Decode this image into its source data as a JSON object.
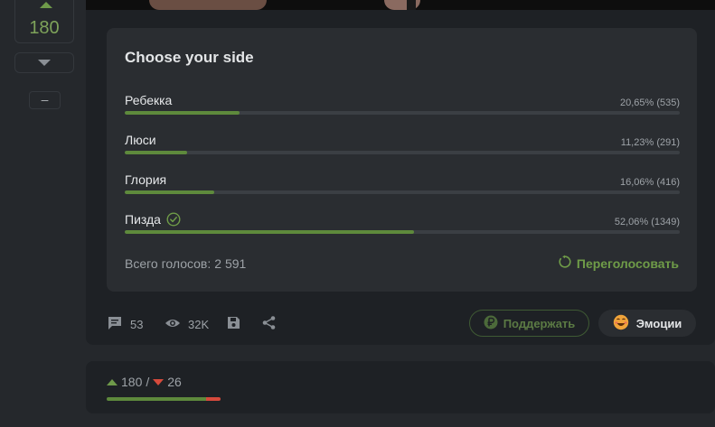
{
  "rating": {
    "score": "180",
    "collapse_label": "–",
    "up": "180",
    "separator": "/",
    "down": "26",
    "up_fraction": 0.8738
  },
  "poll": {
    "title": "Choose your side",
    "options": [
      {
        "label": "Ребекка",
        "stat": "20,65% (535)",
        "percent": 20.65,
        "selected": false
      },
      {
        "label": "Люси",
        "stat": "11,23% (291)",
        "percent": 11.23,
        "selected": false
      },
      {
        "label": "Глория",
        "stat": "16,06% (416)",
        "percent": 16.06,
        "selected": false
      },
      {
        "label": "Пизда",
        "stat": "52,06% (1349)",
        "percent": 52.06,
        "selected": true
      }
    ],
    "total_label": "Всего голосов:",
    "total_value": "2 591",
    "revote_label": "Переголосовать"
  },
  "actions": {
    "comments": "53",
    "views": "32K",
    "support_label": "Поддержать",
    "emotions_label": "Эмоции"
  },
  "icons": {
    "comment": "comment-icon",
    "views": "eye-icon",
    "save": "save-icon",
    "share": "share-icon",
    "support": "ruble-icon",
    "emotions": "emoji-face-icon",
    "revote": "refresh-icon",
    "check": "check-circle-icon"
  },
  "colors": {
    "accent_green": "#5e8a3c",
    "down_red": "#d64a3c"
  }
}
